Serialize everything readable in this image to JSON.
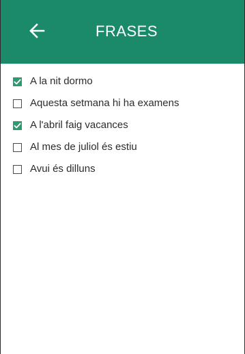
{
  "header": {
    "title": "FRASES",
    "back_icon": "arrow-left-icon",
    "background_color": "#1b8a6b"
  },
  "phrases": [
    {
      "label": "A la nit dormo",
      "checked": true
    },
    {
      "label": "Aquesta setmana hi ha examens",
      "checked": false
    },
    {
      "label": "A l'abril faig vacances",
      "checked": true
    },
    {
      "label": "Al mes de juliol és estiu",
      "checked": false
    },
    {
      "label": "Avui és dilluns",
      "checked": false
    }
  ],
  "colors": {
    "checkbox_checked": "#2f9a6f",
    "text": "#2b2b2b"
  }
}
